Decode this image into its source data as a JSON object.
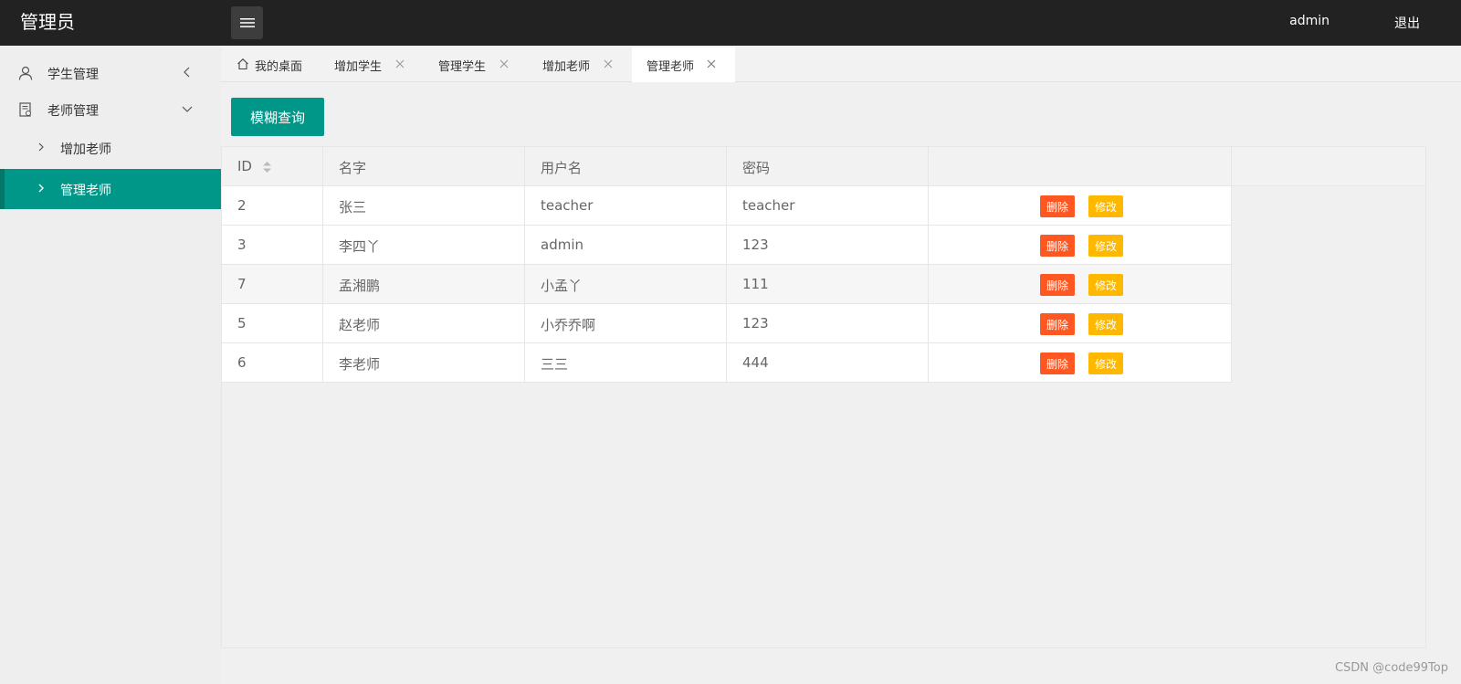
{
  "app": {
    "title": "管理员",
    "menu_toggle_icon": "hamburger-icon",
    "user": "admin",
    "logout": "退出"
  },
  "sidebar": {
    "groups": [
      {
        "label": "学生管理",
        "icon": "user-icon",
        "expanded": false
      },
      {
        "label": "老师管理",
        "icon": "document-icon",
        "expanded": true
      }
    ],
    "sub_items": [
      {
        "label": "增加老师",
        "active": false
      },
      {
        "label": "管理老师",
        "active": true
      }
    ]
  },
  "tabs": [
    {
      "label": "我的桌面",
      "icon": "home-icon",
      "closable": false
    },
    {
      "label": "增加学生",
      "closable": true
    },
    {
      "label": "管理学生",
      "closable": true
    },
    {
      "label": "增加老师",
      "closable": true
    },
    {
      "label": "管理老师",
      "closable": true,
      "active": true
    }
  ],
  "toolbar": {
    "search_label": "模糊查询"
  },
  "table": {
    "headers": [
      "ID",
      "名字",
      "用户名",
      "密码",
      ""
    ],
    "rows": [
      {
        "id": "2",
        "name": "张三",
        "username": "teacher",
        "password": "teacher"
      },
      {
        "id": "3",
        "name": "李四丫",
        "username": "admin",
        "password": "123"
      },
      {
        "id": "7",
        "name": "孟湘鹏",
        "username": "小孟丫",
        "password": "111"
      },
      {
        "id": "5",
        "name": "赵老师",
        "username": "小乔乔啊",
        "password": "123"
      },
      {
        "id": "6",
        "name": "李老师",
        "username": "三三",
        "password": "444"
      }
    ],
    "delete_label": "删除",
    "edit_label": "修改"
  },
  "watermark": "CSDN @code99Top",
  "colors": {
    "header_bg": "#222222",
    "accent": "#009688",
    "delete": "#ff5722",
    "edit": "#ffb800"
  }
}
